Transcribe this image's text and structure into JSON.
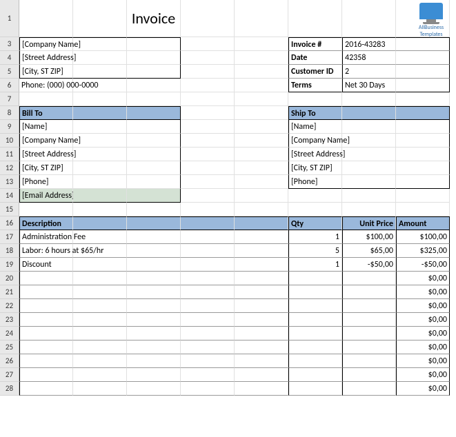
{
  "branding": {
    "line1": "AllBusiness",
    "line2": "Templates"
  },
  "title": "Invoice",
  "company": {
    "name": "[Company Name]",
    "street": "[Street Address]",
    "citystzip": "[City, ST ZIP]",
    "phone": "Phone: (000) 000-0000"
  },
  "meta": {
    "invoice_label": "Invoice #",
    "invoice_value": "2016-43283",
    "date_label": "Date",
    "date_value": "42358",
    "cust_label": "Customer ID",
    "cust_value": "2",
    "terms_label": "Terms",
    "terms_value": "Net 30 Days"
  },
  "billto": {
    "header": "Bill To",
    "name": "[Name]",
    "company": "[Company Name]",
    "street": "[Street Address]",
    "citystzip": "[City, ST ZIP]",
    "phone": "[Phone]",
    "email": "[Email Address]"
  },
  "shipto": {
    "header": "Ship To",
    "name": "[Name]",
    "company": "[Company Name]",
    "street": "[Street Address]",
    "citystzip": "[City, ST ZIP]",
    "phone": "[Phone]"
  },
  "table": {
    "hdr_desc": "Description",
    "hdr_qty": "Qty",
    "hdr_unit": "Unit Price",
    "hdr_amount": "Amount"
  },
  "lines": [
    {
      "desc": "Administration Fee",
      "qty": "1",
      "unit": "$100,00",
      "amount": "$100,00"
    },
    {
      "desc": "Labor: 6 hours at $65/hr",
      "qty": "5",
      "unit": "$65,00",
      "amount": "$325,00"
    },
    {
      "desc": "Discount",
      "qty": "1",
      "unit": "-$50,00",
      "amount": "-$50,00"
    },
    {
      "desc": "",
      "qty": "",
      "unit": "",
      "amount": "$0,00"
    },
    {
      "desc": "",
      "qty": "",
      "unit": "",
      "amount": "$0,00"
    },
    {
      "desc": "",
      "qty": "",
      "unit": "",
      "amount": "$0,00"
    },
    {
      "desc": "",
      "qty": "",
      "unit": "",
      "amount": "$0,00"
    },
    {
      "desc": "",
      "qty": "",
      "unit": "",
      "amount": "$0,00"
    },
    {
      "desc": "",
      "qty": "",
      "unit": "",
      "amount": "$0,00"
    },
    {
      "desc": "",
      "qty": "",
      "unit": "",
      "amount": "$0,00"
    },
    {
      "desc": "",
      "qty": "",
      "unit": "",
      "amount": "$0,00"
    },
    {
      "desc": "",
      "qty": "",
      "unit": "",
      "amount": "$0,00"
    }
  ],
  "rowlabels": [
    "1",
    "3",
    "4",
    "5",
    "6",
    "7",
    "8",
    "9",
    "10",
    "11",
    "12",
    "13",
    "14",
    "15",
    "16",
    "17",
    "18",
    "19",
    "20",
    "21",
    "22",
    "23",
    "24",
    "25",
    "26",
    "27",
    "28"
  ]
}
